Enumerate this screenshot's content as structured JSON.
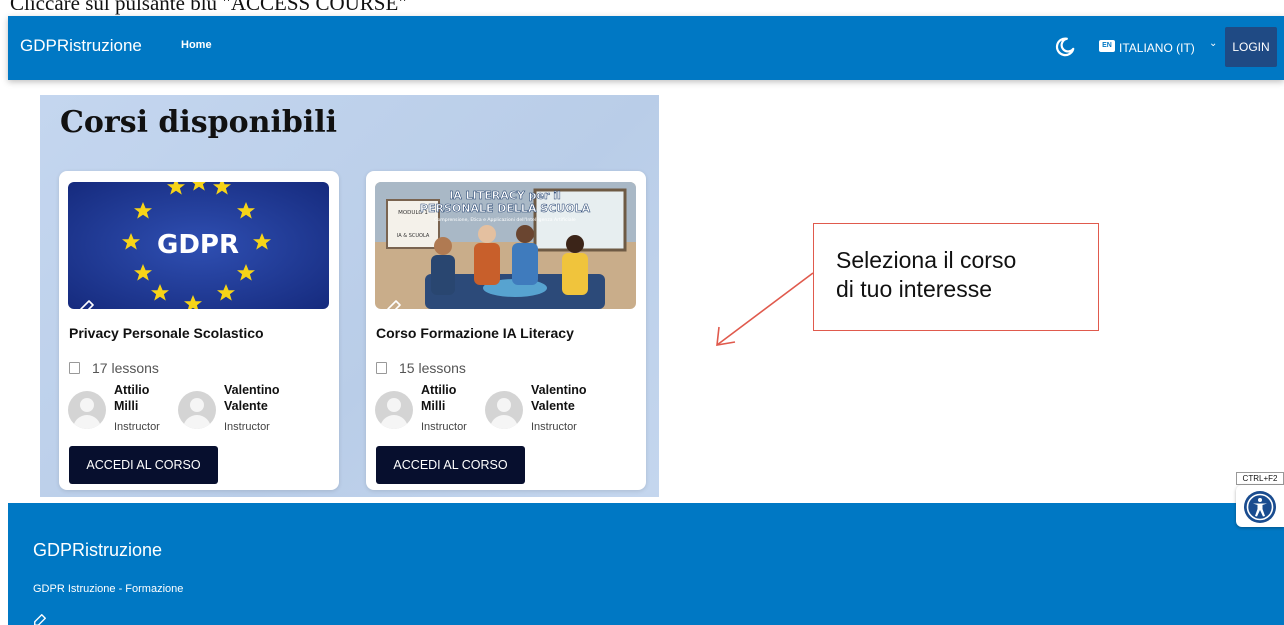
{
  "caption": {
    "text": "Cliccare sul pulsante blu \"ACCESS COURSE\""
  },
  "navbar": {
    "brand": "GDPRistruzione",
    "home_link": "Home",
    "theme_icon": "moon-icon",
    "language": {
      "flag_text": "EN",
      "label": "ITALIANO (IT)",
      "chevron": "⌄"
    },
    "login_label": "LOGIN",
    "color": "#0078c4"
  },
  "main": {
    "section_title": "Corsi disponibili",
    "courses": [
      {
        "image_text": "GDPR",
        "title": "Privacy Personale Scolastico",
        "lessons": "17 lessons",
        "instructors": [
          {
            "first": "Attilio",
            "last": "Milli",
            "role": "Instructor"
          },
          {
            "first": "Valentino",
            "last": "Valente",
            "role": "Instructor"
          }
        ],
        "button": "ACCEDI AL CORSO"
      },
      {
        "image_title_1": "IA LITERACY per il",
        "image_title_2": "PERSONALE DELLA SCUOLA",
        "image_subtitle": "Comprensione, Etica e Applicazioni dell'Intelligenza Artificiale",
        "image_sign_1": "MODULO 1",
        "image_sign_2": "IA & SCUOLA",
        "title": "Corso Formazione IA Literacy",
        "lessons": "15 lessons",
        "instructors": [
          {
            "first": "Attilio",
            "last": "Milli",
            "role": "Instructor"
          },
          {
            "first": "Valentino",
            "last": "Valente",
            "role": "Instructor"
          }
        ],
        "button": "ACCEDI AL CORSO"
      }
    ]
  },
  "callout": {
    "text": "Seleziona il corso\ndi tuo interesse",
    "border_color": "#e05a4d"
  },
  "footer": {
    "brand": "GDPRistruzione",
    "subtitle": "GDPR Istruzione - Formazione"
  },
  "accessibility": {
    "shortcut": "CTRL+F2"
  },
  "colors": {
    "primary": "#0078c4",
    "button_dark": "#070f2e",
    "login_bg": "#1f4a84"
  }
}
